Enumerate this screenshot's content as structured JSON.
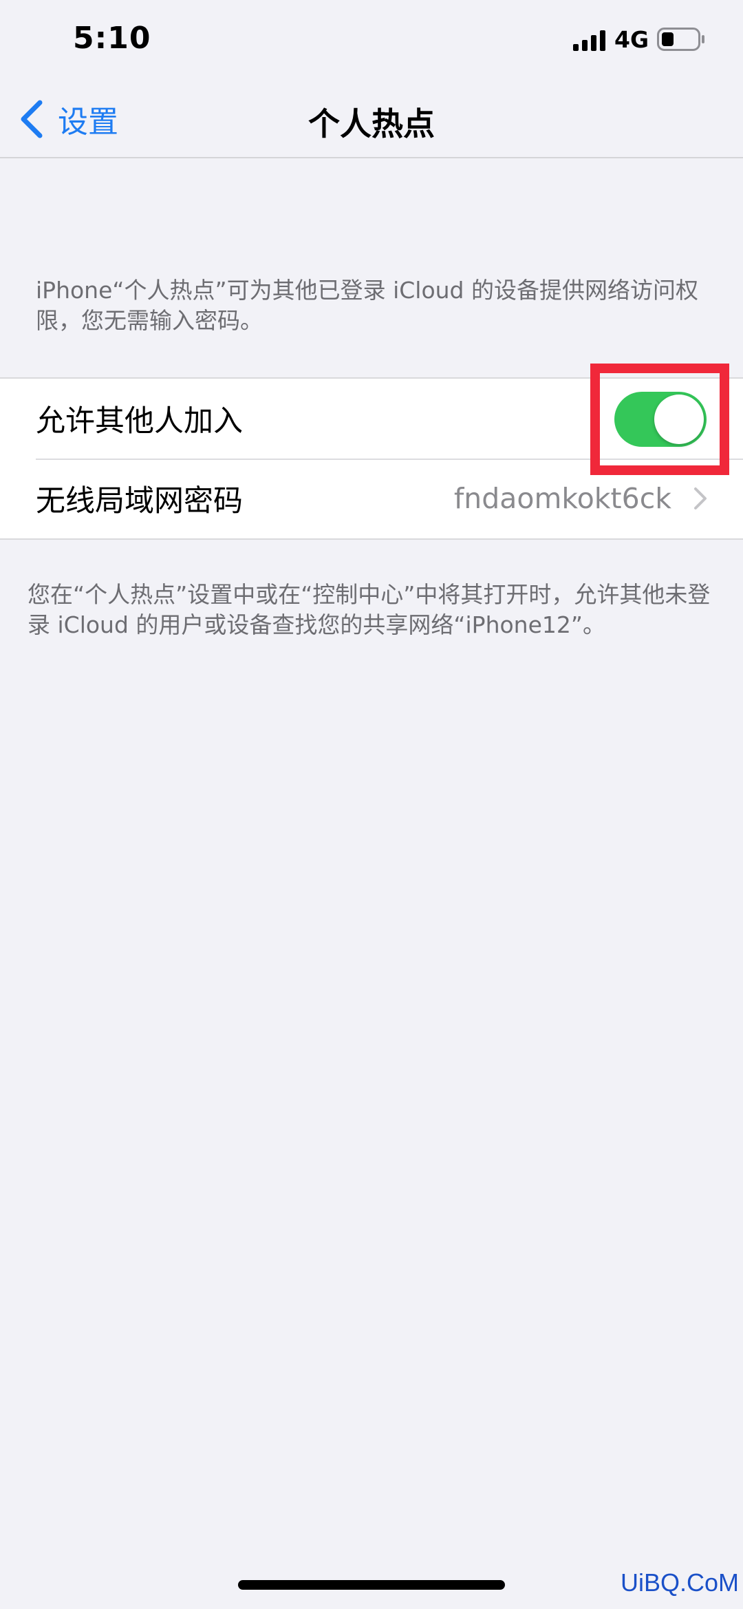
{
  "status_bar": {
    "time": "5:10",
    "network": "4G",
    "signal_icon": "cellular-signal-icon",
    "battery_icon": "battery-low-icon"
  },
  "nav": {
    "back_label": "设置",
    "title": "个人热点"
  },
  "header_note": "iPhone“个人热点”可为其他已登录 iCloud 的设备提供网络访问权限，您无需输入密码。",
  "rows": [
    {
      "label": "允许其他人加入",
      "type": "toggle",
      "on": true
    },
    {
      "label": "无线局域网密码",
      "value": "fndaomkokt6ck",
      "type": "disclosure"
    }
  ],
  "footer_note": "您在“个人热点”设置中或在“控制中心”中将其打开时，允许其他未登录 iCloud 的用户或设备查找您的共享网络“iPhone12”。",
  "watermark": "UiBQ.CoM",
  "colors": {
    "background": "#F2F2F7",
    "accent": "#1E7CF2",
    "toggle_on": "#34C759",
    "highlight": "#F0283A"
  }
}
